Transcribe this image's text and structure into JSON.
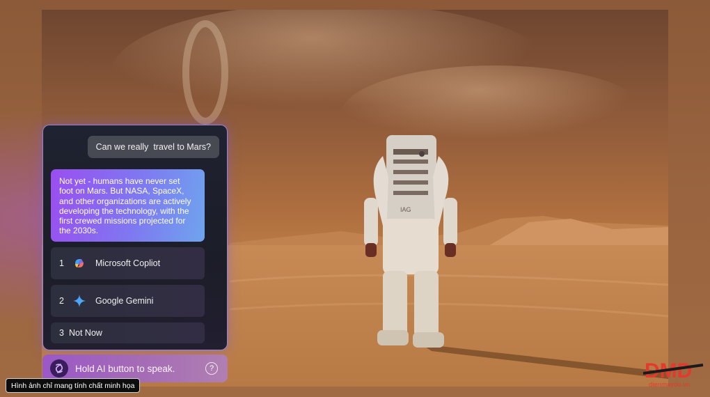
{
  "chat": {
    "user_message": "Can we really  travel to Mars?",
    "ai_response": "Not yet - humans have never set\nfoot on Mars. But NASA, SpaceX,\nand other organizations are  actively\ndeveloping the technology,  with the\nfirst crewed missions  projected for\nthe 2030s."
  },
  "options": [
    {
      "number": "1",
      "label": "Microsoft Copliot",
      "icon": "copilot-icon"
    },
    {
      "number": "2",
      "label": "Google Gemini",
      "icon": "gemini-icon"
    },
    {
      "number": "3",
      "label": "Not Now"
    }
  ],
  "hold_bar": {
    "label": "Hold AI button to speak.",
    "help_symbol": "?"
  },
  "caption": "Hình ảnh chỉ mang tính chất minh họa",
  "watermark": {
    "brand": "DMD",
    "site": "dienmaydo.vn"
  },
  "scene": {
    "suit_label": "IAG"
  },
  "colors": {
    "panel_border": "#aa96ff",
    "ai_bubble_start": "#9a4ef0",
    "ai_bubble_end": "#6fa4ee",
    "brand_red": "#e23b2e"
  }
}
